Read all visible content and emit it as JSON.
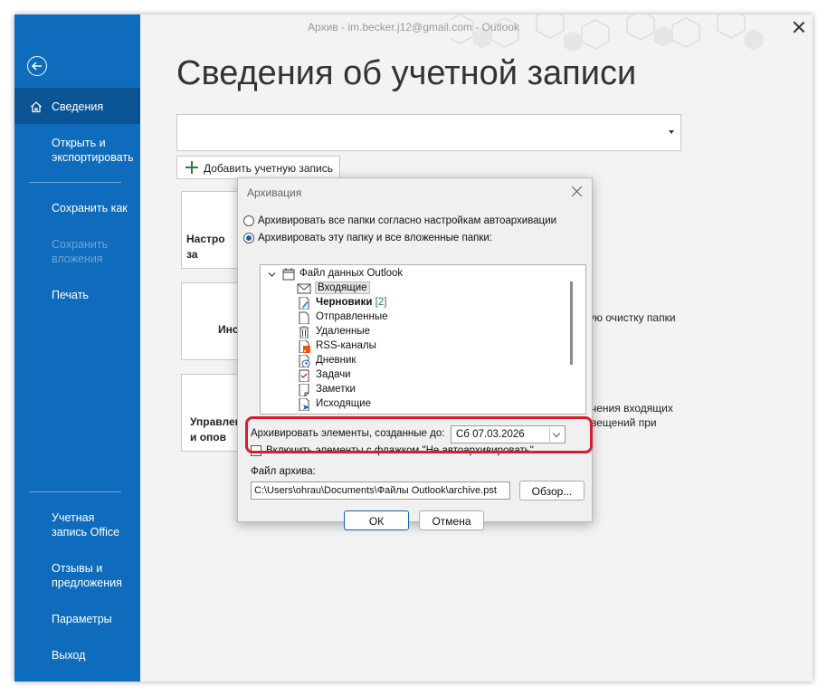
{
  "window": {
    "title": "Архив - im.becker.j12@gmail.com  -  Outlook"
  },
  "sidebar": {
    "items": [
      {
        "label": "Сведения"
      },
      {
        "label": "Открыть и экспортировать"
      },
      {
        "label": "Сохранить как"
      },
      {
        "label": "Сохранить вложения"
      },
      {
        "label": "Печать"
      },
      {
        "label": "Учетная запись Office"
      },
      {
        "label": "Отзывы и предложения"
      },
      {
        "label": "Параметры"
      },
      {
        "label": "Выход"
      }
    ]
  },
  "main": {
    "title": "Сведения об учетной записи",
    "add_account_label": "Добавить учетную запись",
    "tiles": [
      {
        "label": "Настро\nза"
      },
      {
        "label": "Инс"
      },
      {
        "label": "Управлен\nи опов"
      }
    ],
    "bg_texts": [
      "ую очистку папки",
      "чения входящих",
      "вещений при"
    ]
  },
  "dialog": {
    "title": "Архивация",
    "radio_all": "Архивировать все папки согласно настройкам автоархивации",
    "radio_this": "Архивировать эту папку и все вложенные папки:",
    "tree": {
      "root": "Файл данных Outlook",
      "items": [
        {
          "label": "Входящие",
          "icon": "envelope-icon"
        },
        {
          "label": "Черновики",
          "badge": "[2]",
          "icon": "drafts-icon"
        },
        {
          "label": "Отправленные",
          "icon": "folder-icon"
        },
        {
          "label": "Удаленные",
          "icon": "trash-icon"
        },
        {
          "label": "RSS-каналы",
          "icon": "rss-icon"
        },
        {
          "label": "Дневник",
          "icon": "journal-icon"
        },
        {
          "label": "Задачи",
          "icon": "tasks-icon"
        },
        {
          "label": "Заметки",
          "icon": "notes-icon"
        },
        {
          "label": "Исходящие",
          "icon": "outbox-icon"
        }
      ]
    },
    "archive_before_label": "Архивировать элементы, созданные до:",
    "archive_before_value": "Сб 07.03.2026",
    "include_flagged_label": "Включить элементы с флажком \"Не автоархивировать\"",
    "file_label": "Файл архива:",
    "file_path": "C:\\Users\\ohrau\\Documents\\Файлы Outlook\\archive.pst",
    "browse_label": "Обзор...",
    "ok_label": "ОК",
    "cancel_label": "Отмена"
  },
  "colors": {
    "sidebar": "#0f6cbd",
    "sidebar_active": "#0a5494",
    "highlight": "#d81e2d"
  }
}
